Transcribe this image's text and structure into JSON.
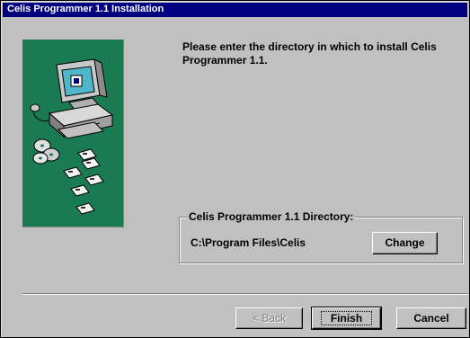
{
  "window": {
    "title": "Celis Programmer 1.1 Installation"
  },
  "main": {
    "instruction": "Please enter the directory in which to install Celis Programmer 1.1."
  },
  "directory_group": {
    "label": "Celis Programmer 1.1 Directory:",
    "path": "C:\\Program Files\\Celis",
    "change_label": "Change"
  },
  "buttons": {
    "back_label": "< Back",
    "finish_label": "Finish",
    "cancel_label": "Cancel"
  },
  "icons": {
    "illustration": "computer-with-disks-illustration"
  },
  "colors": {
    "titlebar": "#000080",
    "dialog_face": "#c0c0c0",
    "illustration_background": "#1a7a52"
  }
}
